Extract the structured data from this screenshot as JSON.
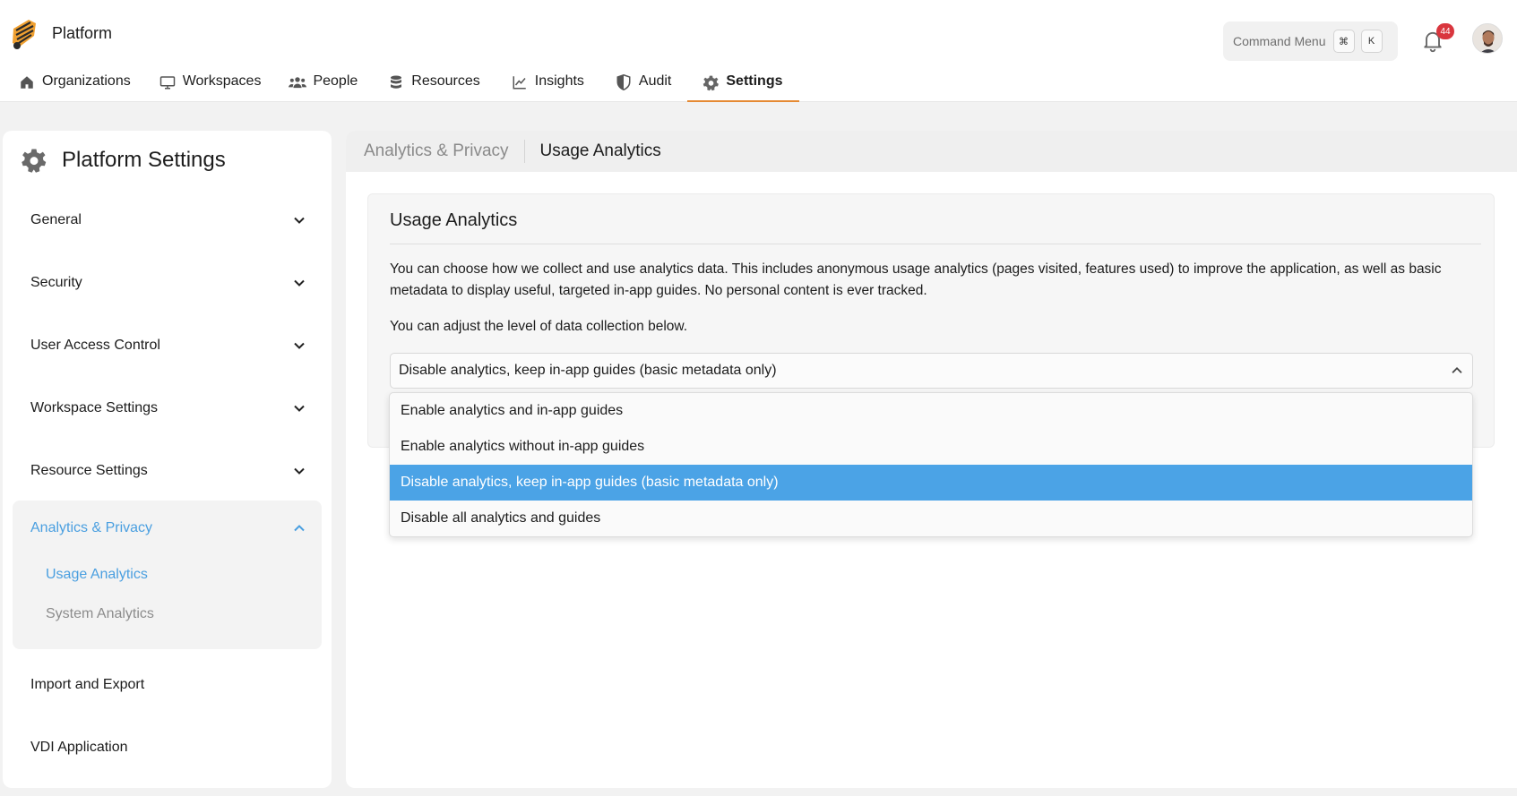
{
  "header": {
    "app_title": "Platform",
    "command_menu": {
      "label": "Command Menu",
      "key1": "⌘",
      "key2": "K"
    },
    "notifications_count": "44"
  },
  "nav": {
    "items": [
      {
        "label": "Organizations",
        "icon": "home-icon"
      },
      {
        "label": "Workspaces",
        "icon": "monitor-icon"
      },
      {
        "label": "People",
        "icon": "people-icon"
      },
      {
        "label": "Resources",
        "icon": "database-icon"
      },
      {
        "label": "Insights",
        "icon": "chart-line-icon"
      },
      {
        "label": "Audit",
        "icon": "shield-icon"
      },
      {
        "label": "Settings",
        "icon": "gear-icon",
        "active": true
      }
    ],
    "active_underline_color": "#e58a33"
  },
  "sidebar": {
    "title": "Platform Settings",
    "items": [
      {
        "label": "General"
      },
      {
        "label": "Security"
      },
      {
        "label": "User Access Control"
      },
      {
        "label": "Workspace Settings"
      },
      {
        "label": "Resource Settings"
      },
      {
        "label": "Analytics & Privacy",
        "expanded": true
      },
      {
        "label": "Import and Export"
      },
      {
        "label": "VDI Application"
      }
    ],
    "sub_items": [
      {
        "label": "Usage Analytics",
        "active": true
      },
      {
        "label": "System Analytics"
      }
    ],
    "accent_color": "#4a9fe0"
  },
  "main": {
    "breadcrumb": {
      "parent": "Analytics & Privacy",
      "current": "Usage Analytics"
    },
    "card": {
      "title": "Usage Analytics",
      "description": "You can choose how we collect and use analytics data. This includes anonymous usage analytics (pages visited, features used) to improve the application, as well as basic metadata to display useful, targeted in-app guides. No personal content is ever tracked.",
      "adjust_text": "You can adjust the level of data collection below.",
      "select": {
        "value": "Disable analytics, keep in-app guides (basic metadata only)",
        "options": [
          "Enable analytics and in-app guides",
          "Enable analytics without in-app guides",
          "Disable analytics, keep in-app guides (basic metadata only)",
          "Disable all analytics and guides"
        ],
        "selected_index": 2,
        "highlight_color": "#4ba3e6"
      }
    }
  }
}
